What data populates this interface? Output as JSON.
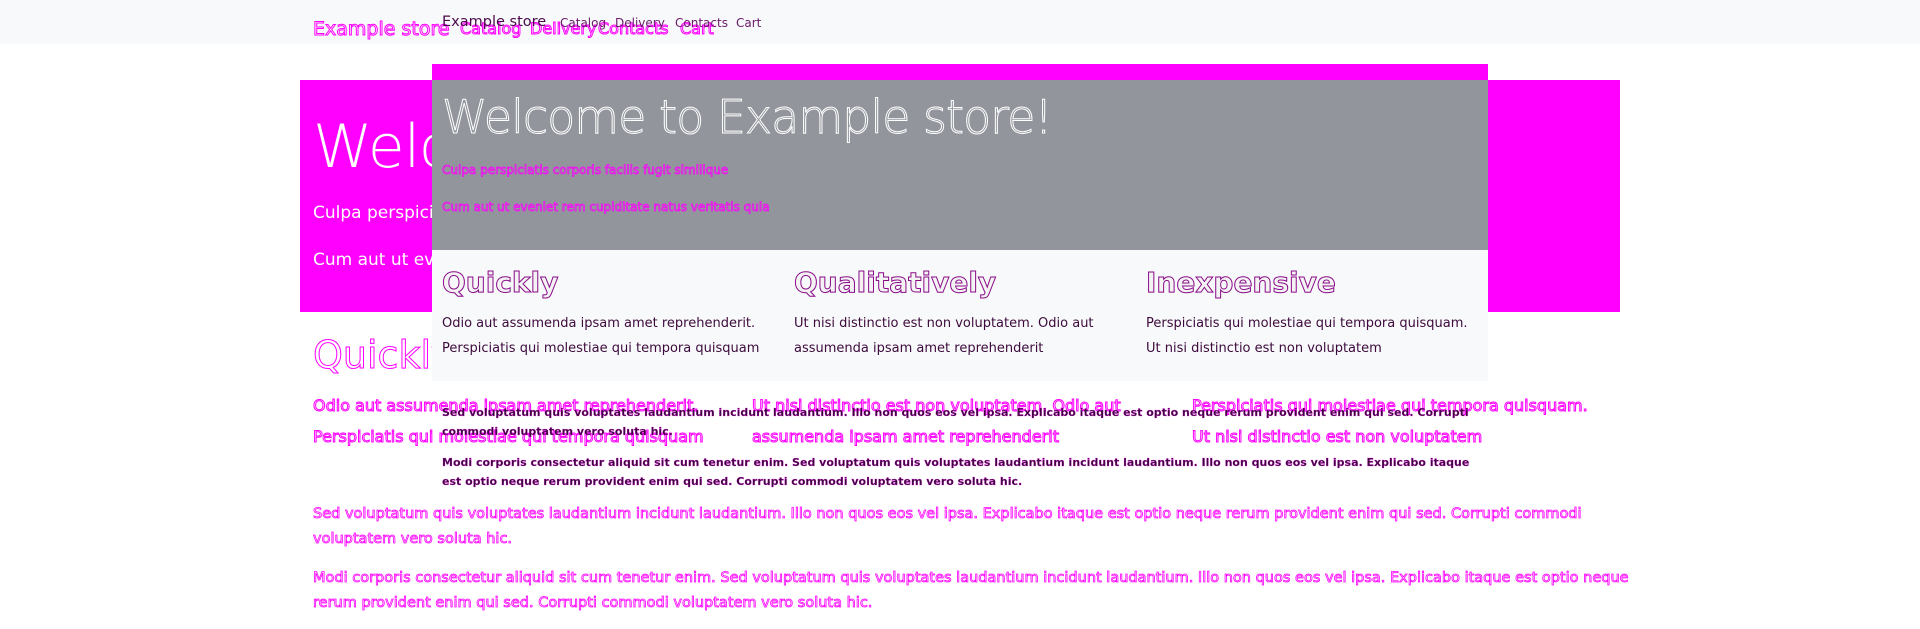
{
  "colors": {
    "accent": "#ff00ff",
    "jumbotron_gray": "#92959c",
    "navbar_bg": "#f8f9fa"
  },
  "navbar": {
    "brand": "Example store",
    "links": [
      "Catalog",
      "Delivery",
      "Contacts",
      "Cart"
    ]
  },
  "jumbotron": {
    "title": "Welcome to Example store!",
    "lead1": "Culpa perspiciatis corporis facilis fugit similique",
    "lead2": "Cum aut ut eveniet rem cupiditate natus veritatis quia"
  },
  "features": [
    {
      "title": "Quickly",
      "line1": "Odio aut assumenda ipsam amet reprehenderit.",
      "line2": "Perspiciatis qui molestiae qui tempora quisquam"
    },
    {
      "title": "Qualitatively",
      "line1": "Ut nisi distinctio est non voluptatem. Odio aut",
      "line2": "assumenda ipsam amet reprehenderit"
    },
    {
      "title": "Inexpensive",
      "line1": "Perspiciatis qui molestiae qui tempora quisquam.",
      "line2": "Ut nisi distinctio est non voluptatem"
    }
  ],
  "paragraphs": [
    "Sed voluptatum quis voluptates laudantium incidunt laudantium. Illo non quos eos vel ipsa. Explicabo itaque est optio neque rerum provident enim qui sed. Corrupti commodi voluptatem vero soluta hic.",
    "Modi corporis consectetur aliquid sit cum tenetur enim. Sed voluptatum quis voluptates laudantium incidunt laudantium. Illo non quos eos vel ipsa. Explicabo itaque est optio neque rerum provident enim qui sed. Corrupti commodi voluptatem vero soluta hic."
  ]
}
